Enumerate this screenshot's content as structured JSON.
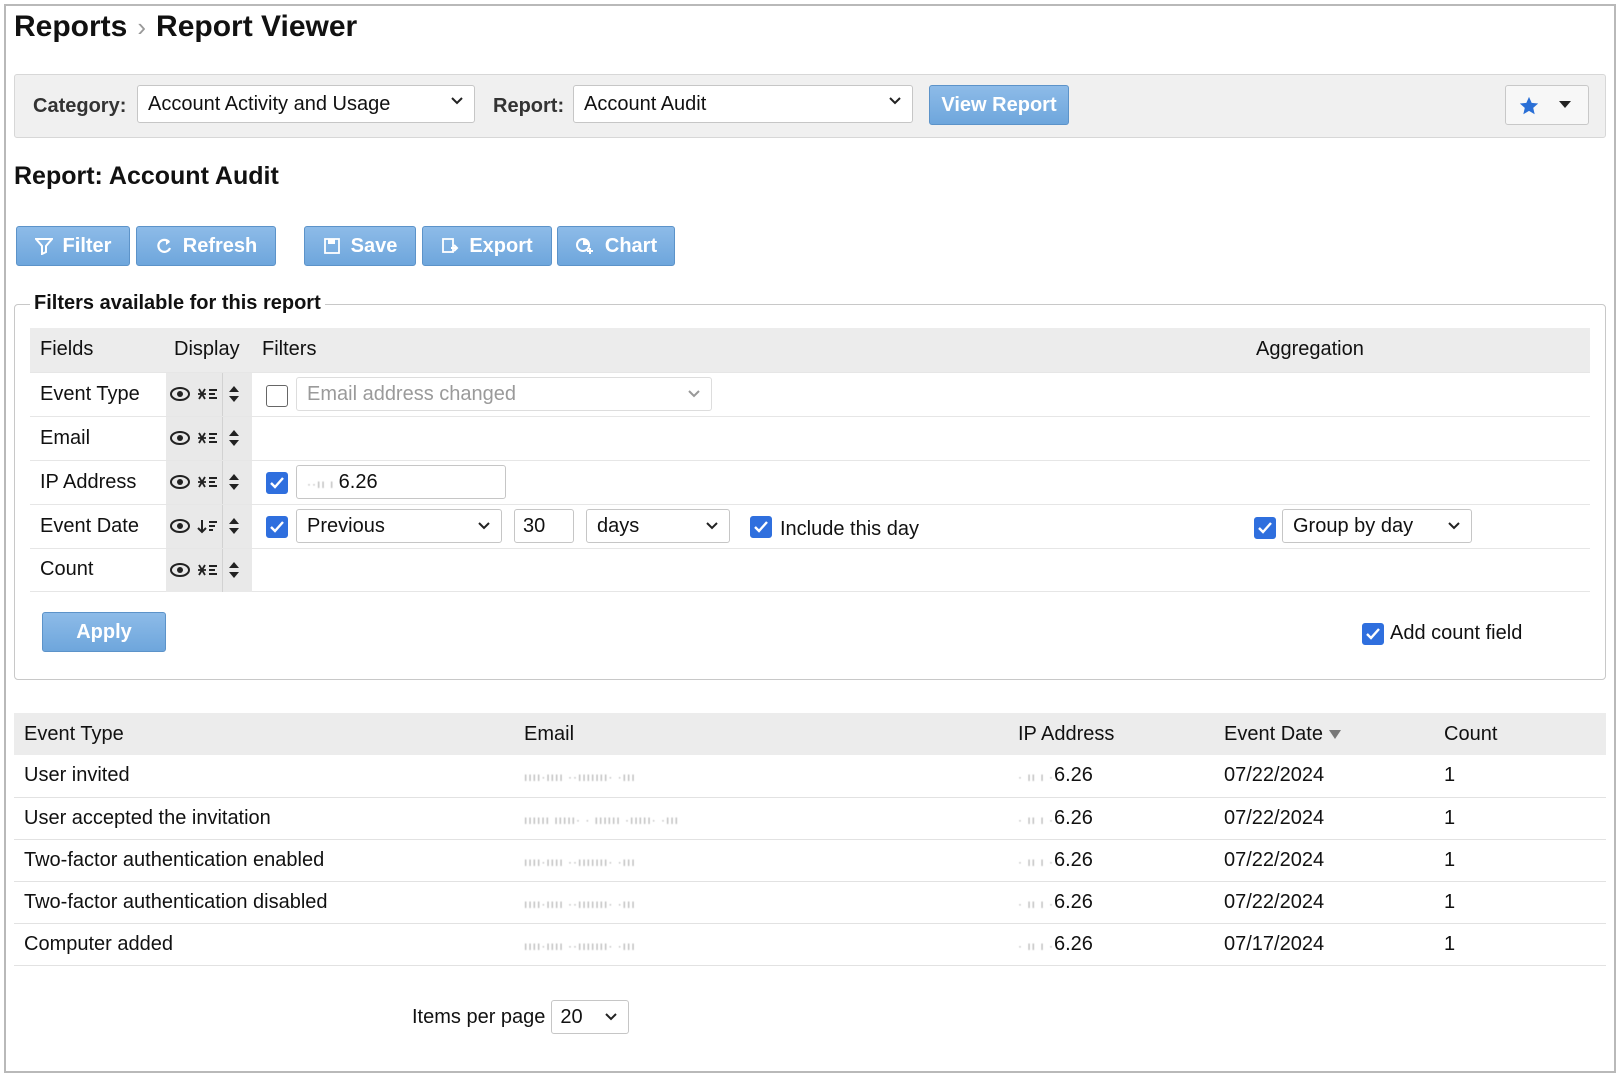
{
  "breadcrumb": {
    "parent": "Reports",
    "separator": "›",
    "current": "Report Viewer"
  },
  "selector": {
    "category_label": "Category:",
    "category_value": "Account Activity and Usage",
    "report_label": "Report:",
    "report_value": "Account Audit",
    "view_button": "View Report"
  },
  "report_title": "Report: Account Audit",
  "toolbar": {
    "filter": "Filter",
    "refresh": "Refresh",
    "save": "Save",
    "export": "Export",
    "chart": "Chart"
  },
  "filters": {
    "legend": "Filters available for this report",
    "headers": {
      "fields": "Fields",
      "display": "Display",
      "filters": "Filters",
      "aggregation": "Aggregation"
    },
    "rows": {
      "event_type": {
        "field": "Event Type",
        "enabled": false,
        "select_value": "Email address changed"
      },
      "email": {
        "field": "Email"
      },
      "ip_address": {
        "field": "IP Address",
        "enabled": true,
        "value": "6.26"
      },
      "event_date": {
        "field": "Event Date",
        "enabled": true,
        "period": "Previous",
        "amount": "30",
        "unit": "days",
        "include_label": "Include this day",
        "include_checked": true,
        "aggregation_checked": true,
        "aggregation_value": "Group by day"
      },
      "count": {
        "field": "Count"
      }
    },
    "apply": "Apply",
    "add_count_label": "Add count field",
    "add_count_checked": true
  },
  "results": {
    "headers": {
      "event_type": "Event Type",
      "email": "Email",
      "ip": "IP Address",
      "date": "Event Date",
      "count": "Count"
    },
    "rows": [
      {
        "event_type": "User invited",
        "ip": "6.26",
        "date": "07/22/2024",
        "count": "1"
      },
      {
        "event_type": "User accepted the invitation",
        "ip": "6.26",
        "date": "07/22/2024",
        "count": "1"
      },
      {
        "event_type": "Two-factor authentication enabled",
        "ip": "6.26",
        "date": "07/22/2024",
        "count": "1"
      },
      {
        "event_type": "Two-factor authentication disabled",
        "ip": "6.26",
        "date": "07/22/2024",
        "count": "1"
      },
      {
        "event_type": "Computer added",
        "ip": "6.26",
        "date": "07/17/2024",
        "count": "1"
      }
    ]
  },
  "pager": {
    "label": "Items per page",
    "value": "20"
  },
  "colors": {
    "button_blue": "#7aaee0",
    "checkbox_blue": "#2f6fde",
    "star": "#2a6fd6"
  }
}
